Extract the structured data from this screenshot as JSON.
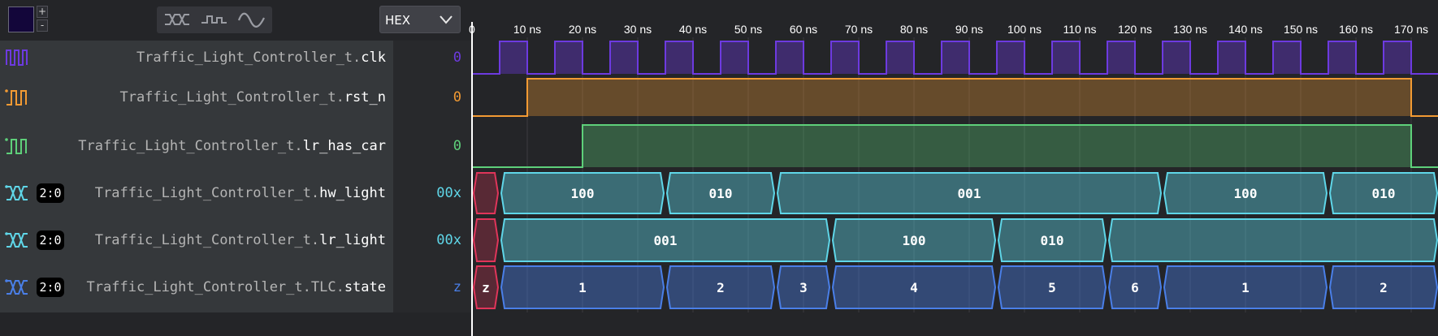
{
  "toolbar": {
    "zoom_in_label": "+",
    "zoom_out_label": "-",
    "swatch_color": "#13063a",
    "render_modes": [
      "bus-render-icon",
      "step-render-icon",
      "analog-render-icon"
    ],
    "radix": "HEX"
  },
  "timeline": {
    "start_label": "0",
    "unit": "ns",
    "ticks": [
      "10 ns",
      "20 ns",
      "30 ns",
      "40 ns",
      "50 ns",
      "60 ns",
      "70 ns",
      "80 ns",
      "90 ns",
      "100 ns",
      "110 ns",
      "120 ns",
      "130 ns",
      "140 ns",
      "150 ns",
      "160 ns",
      "170 ns"
    ],
    "tick_values": [
      10,
      20,
      30,
      40,
      50,
      60,
      70,
      80,
      90,
      100,
      110,
      120,
      130,
      140,
      150,
      160,
      170
    ],
    "range_ns": [
      0,
      175
    ]
  },
  "signals": [
    {
      "scope": "Traffic_Light_Controller_t.",
      "name": "clk",
      "value": "0",
      "color": "#6d3ae0",
      "icon": "clock-signal-icon",
      "width": "",
      "type": "clock",
      "period_ns": 10
    },
    {
      "scope": "Traffic_Light_Controller_t.",
      "name": "rst_n",
      "value": "0",
      "color": "#f29a33",
      "icon": "step-signal-icon",
      "width": "",
      "type": "bit",
      "edges": [
        {
          "t": 0,
          "v": 0
        },
        {
          "t": 10,
          "v": 1
        },
        {
          "t": 170,
          "v": 0
        }
      ]
    },
    {
      "scope": "Traffic_Light_Controller_t.",
      "name": "lr_has_car",
      "value": "0",
      "color": "#5ed07a",
      "icon": "step-signal-icon",
      "width": "",
      "type": "bit",
      "edges": [
        {
          "t": 0,
          "v": 0
        },
        {
          "t": 20,
          "v": 1
        },
        {
          "t": 170,
          "v": 0
        }
      ]
    },
    {
      "scope": "Traffic_Light_Controller_t.",
      "name": "hw_light",
      "value": "00x",
      "color": "#5fd6e8",
      "icon": "bus-signal-icon",
      "width": "2:0",
      "type": "bus",
      "segments": [
        {
          "t0": 0,
          "t1": 5,
          "label": "",
          "unknown": true
        },
        {
          "t0": 5,
          "t1": 35,
          "label": "100"
        },
        {
          "t0": 35,
          "t1": 55,
          "label": "010"
        },
        {
          "t0": 55,
          "t1": 125,
          "label": "001"
        },
        {
          "t0": 125,
          "t1": 155,
          "label": "100"
        },
        {
          "t0": 155,
          "t1": 175,
          "label": "010"
        }
      ]
    },
    {
      "scope": "Traffic_Light_Controller_t.",
      "name": "lr_light",
      "value": "00x",
      "color": "#5fd6e8",
      "icon": "bus-signal-icon",
      "width": "2:0",
      "type": "bus",
      "segments": [
        {
          "t0": 0,
          "t1": 5,
          "label": "",
          "unknown": true
        },
        {
          "t0": 5,
          "t1": 65,
          "label": "001"
        },
        {
          "t0": 65,
          "t1": 95,
          "label": "100"
        },
        {
          "t0": 95,
          "t1": 115,
          "label": "010"
        },
        {
          "t0": 115,
          "t1": 175,
          "label": ""
        }
      ]
    },
    {
      "scope": "Traffic_Light_Controller_t.TLC.",
      "name": "state",
      "value": "z",
      "color": "#4a7fe8",
      "icon": "bus-signal-icon",
      "width": "2:0",
      "type": "bus",
      "segments": [
        {
          "t0": 0,
          "t1": 5,
          "label": "z",
          "unknown": true
        },
        {
          "t0": 5,
          "t1": 35,
          "label": "1"
        },
        {
          "t0": 35,
          "t1": 55,
          "label": "2"
        },
        {
          "t0": 55,
          "t1": 65,
          "label": "3"
        },
        {
          "t0": 65,
          "t1": 95,
          "label": "4"
        },
        {
          "t0": 95,
          "t1": 115,
          "label": "5"
        },
        {
          "t0": 115,
          "t1": 125,
          "label": "6"
        },
        {
          "t0": 125,
          "t1": 155,
          "label": "1"
        },
        {
          "t0": 155,
          "t1": 175,
          "label": "2"
        }
      ]
    }
  ]
}
